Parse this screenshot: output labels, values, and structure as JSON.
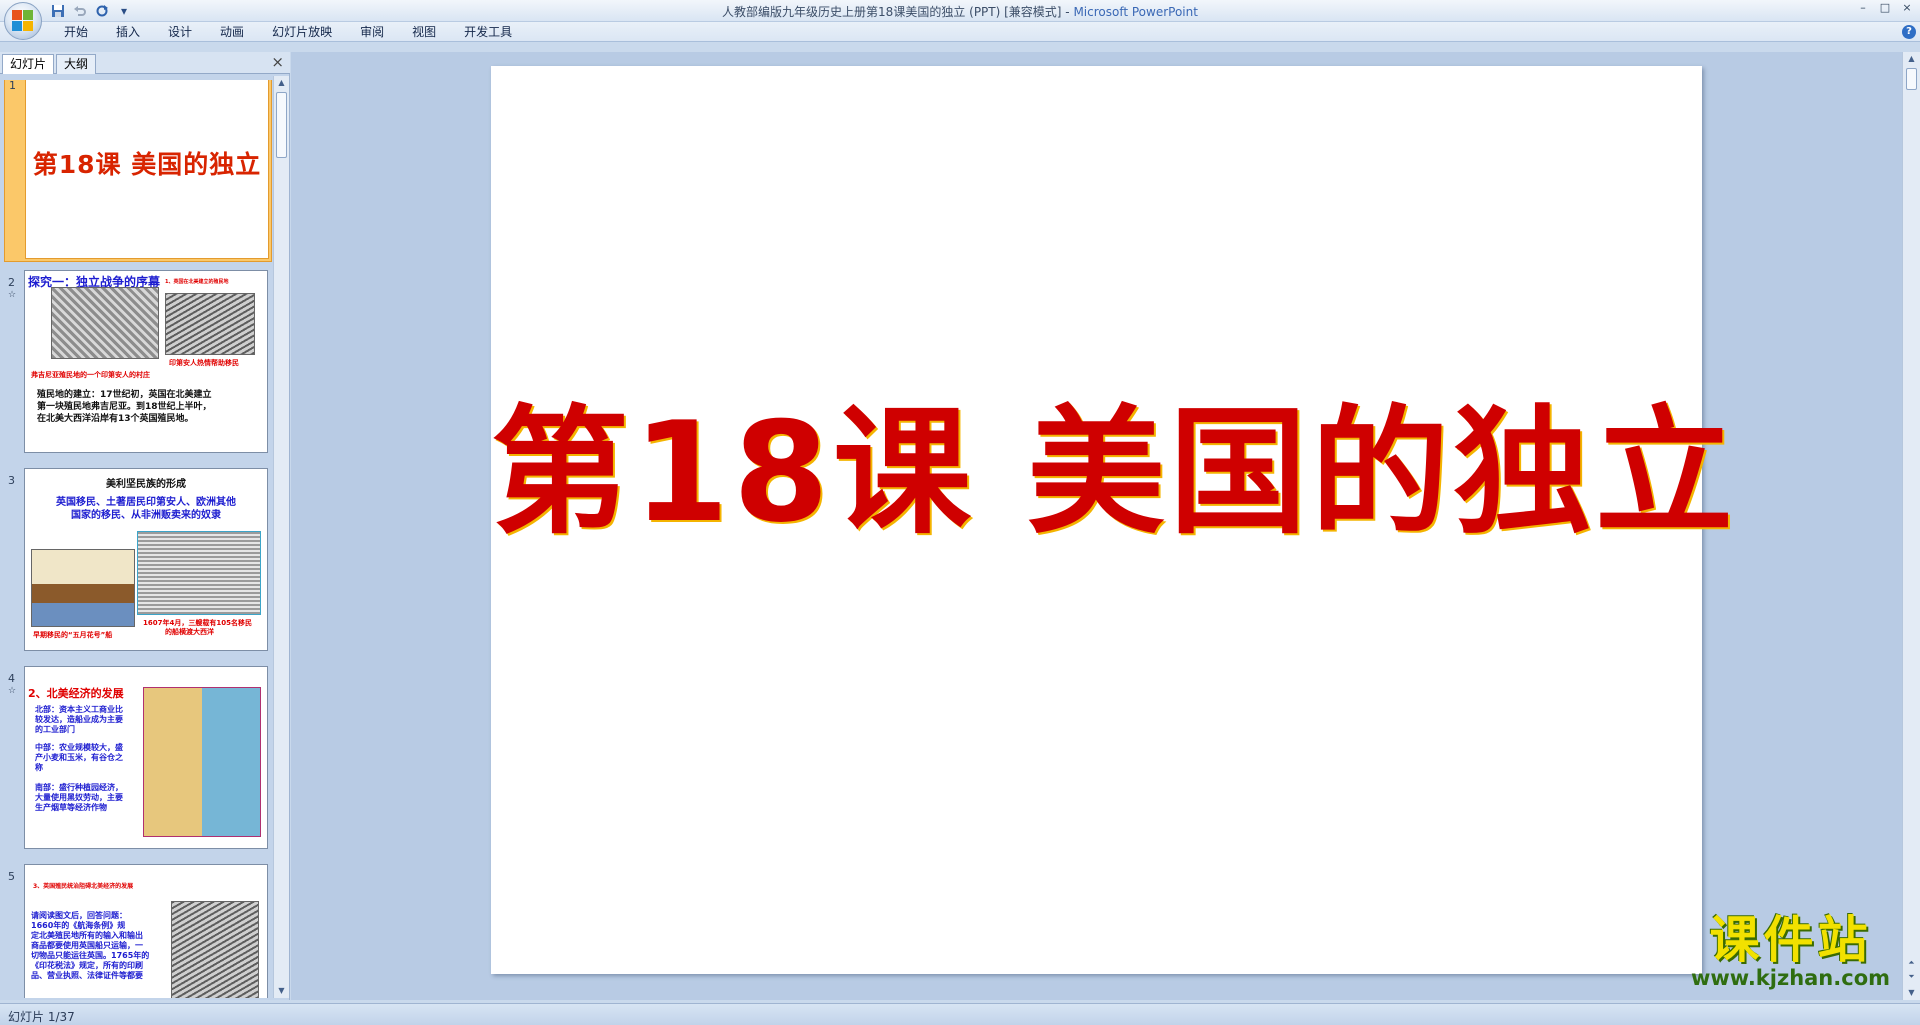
{
  "window": {
    "title": "人教部编版九年级历史上册第18课美国的独立 (PPT) [兼容模式] - ",
    "app_name": "Microsoft PowerPoint",
    "controls": [
      "–",
      "□",
      "×"
    ]
  },
  "quick_access": {
    "save_icon": "save-icon",
    "undo_icon": "undo-icon",
    "redo_icon": "redo-icon",
    "customize": "▾"
  },
  "ribbon": {
    "tabs": [
      "开始",
      "插入",
      "设计",
      "动画",
      "幻灯片放映",
      "审阅",
      "视图",
      "开发工具"
    ],
    "help": "?"
  },
  "left_panel": {
    "tabs": [
      "幻灯片",
      "大纲"
    ],
    "close": "×",
    "slides": [
      {
        "num": "1",
        "title": "第18课  美国的独立"
      },
      {
        "num": "2",
        "star": "☆",
        "title": "探究一：独立战争的序幕",
        "caption_top": "1、英国在北美建立的殖民地",
        "caption_right": "印第安人热情帮助移民",
        "caption_left": "弗吉尼亚殖民地的一个印第安人的村庄",
        "text_lines": [
          "殖民地的建立：17世纪初，英国在北美建立",
          "第一块殖民地弗吉尼亚。到18世纪上半叶，",
          "在北美大西洋沿岸有13个英国殖民地。"
        ]
      },
      {
        "num": "3",
        "title": "美利坚民族的形成",
        "subtitle_lines": [
          "英国移民、土著居民印第安人、欧洲其他",
          "国家的移民、从非洲贩卖来的奴隶"
        ],
        "caption_left": "早期移民的“五月花号”船",
        "caption_right_lines": [
          "1607年4月，三艘载有105名移民",
          "的船横渡大西洋"
        ]
      },
      {
        "num": "4",
        "star": "☆",
        "title": "2、北美经济的发展",
        "text_lines": [
          "北部：资本主义工商业比",
          "较发达，造船业成为主要",
          "的工业部门",
          "",
          "中部：农业规模较大，盛",
          "产小麦和玉米，有谷仓之",
          "称",
          "",
          "南部：盛行种植园经济，",
          "大量使用黑奴劳动，主要",
          "生产烟草等经济作物"
        ]
      },
      {
        "num": "5",
        "title": "3、英国殖民统治阻碍北美经济的发展",
        "text_lines": [
          "请阅读图文后，回答问题：",
          "    1660年的《航海条例》规",
          "定北美殖民地所有的输入和输出",
          "商品都要使用英国船只运输，一",
          "切物品只能运往英国。1765年的",
          "《印花税法》规定，所有的印刷",
          "品、营业执照、法律证件等都要"
        ]
      }
    ]
  },
  "slide": {
    "title": "第18课  美国的独立"
  },
  "watermark": {
    "name": "课件站",
    "url": "www.kjzhan.com"
  },
  "status": {
    "text": "幻灯片 1/37"
  }
}
